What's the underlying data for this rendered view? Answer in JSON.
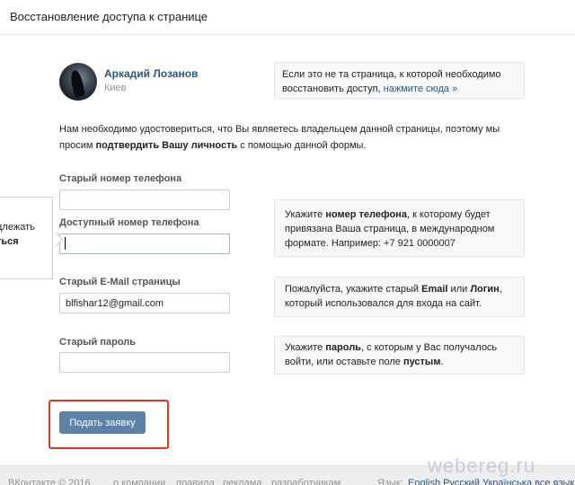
{
  "header": {
    "title": "Восстановление доступа к странице"
  },
  "user": {
    "name": "Аркадий Лозанов",
    "city": "Киев"
  },
  "hint_top": {
    "text": "Если это не та страница, к которой необходимо восстановить доступ,",
    "link": "нажмите сюда »"
  },
  "intro": {
    "part1": "Нам необходимо удостовериться, что Вы являетесь владельцем данной страницы, поэтому мы просим",
    "bold": "подтвердить Вашу личность",
    "part2": "с помощью данной формы."
  },
  "form": {
    "old_phone_label": "Старый номер телефона",
    "old_phone_value": "",
    "new_phone_label": "Доступный номер телефона",
    "new_phone_value": "",
    "old_email_label": "Старый E-Mail страницы",
    "old_email_value": "blfishar12@gmail.com",
    "old_password_label": "Старый пароль",
    "old_password_value": "",
    "submit_label": "Подать заявку"
  },
  "hint_phone": {
    "part1": "Укажите",
    "bold": "номер телефона",
    "part2": ", к которому будет привязана Ваша страница, в международном формате. Например: +7 921 0000007"
  },
  "hint_email": {
    "part1": "Пожалуйста, укажите старый",
    "bold1": "Email",
    "mid": "или",
    "bold2": "Логин",
    "part2": ", который использовался для входа на сайт."
  },
  "hint_password": {
    "part1": "Укажите",
    "bold1": "пароль",
    "part2": ", с которым у Вас получалось войти, или оставьте поле",
    "bold2": "пустым",
    "end": "."
  },
  "popover": {
    "line1": "длежать",
    "line2": "ться"
  },
  "footer": {
    "copyright": "ВКонтакте © 2016",
    "links": [
      "о компании",
      "правила",
      "реклама",
      "разработчикам"
    ],
    "language_label": "Язык:",
    "languages": "English Русский Українська все языки »"
  },
  "watermark": "webereg.ru",
  "colors": {
    "link": "#2a5885",
    "button": "#5e81a8",
    "highlight": "#e0361c"
  }
}
